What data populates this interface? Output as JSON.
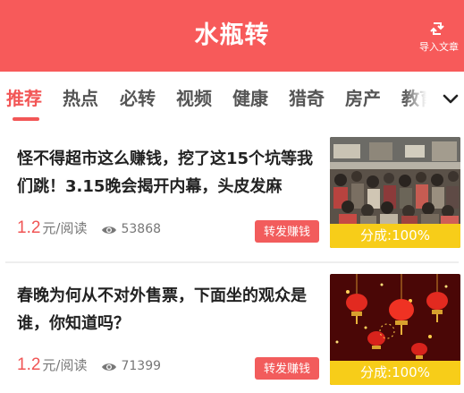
{
  "header": {
    "title": "水瓶转",
    "import_label": "导入文章"
  },
  "tabs": [
    "推荐",
    "热点",
    "必转",
    "视频",
    "健康",
    "猎奇",
    "房产",
    "教育"
  ],
  "articles": [
    {
      "title": "怪不得超市这么赚钱，挖了这15个坑等我们跳！3.15晚会揭开内幕，头皮发麻",
      "price": "1.2",
      "price_unit": "元/阅读",
      "views": "53868",
      "share_button": "转发赚钱",
      "share_ratio": "分成:100%"
    },
    {
      "title": "春晚为何从不对外售票，下面坐的观众是谁，你知道吗？",
      "price": "1.2",
      "price_unit": "元/阅读",
      "views": "71399",
      "share_button": "转发赚钱",
      "share_ratio": "分成:100%"
    }
  ],
  "colors": {
    "brand": "#f75a5a",
    "accent": "#f25656",
    "ratio_badge": "#f7cd19"
  }
}
